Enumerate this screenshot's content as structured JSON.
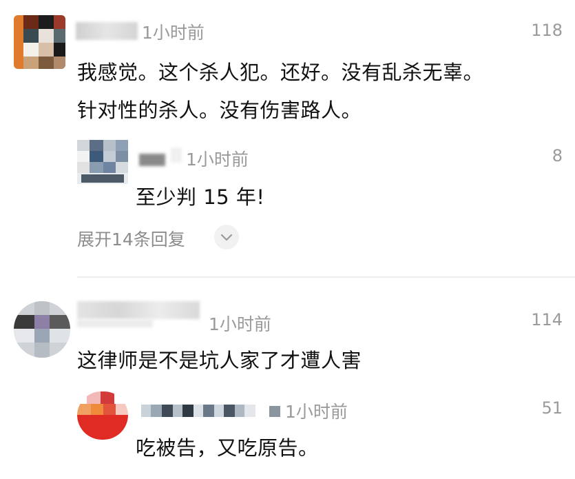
{
  "comments": [
    {
      "time": "1小时前",
      "likes": "118",
      "text_line1": "我感觉。这个杀人犯。还好。没有乱杀无辜。",
      "text_line2": "针对性的杀人。没有伤害路人。",
      "reply": {
        "time": "1小时前",
        "likes": "8",
        "text": "至少判 15 年!"
      },
      "expand_label": "展开14条回复"
    },
    {
      "time": "1小时前",
      "likes": "114",
      "text": "这律师是不是坑人家了才遭人害",
      "reply": {
        "time": "1小时前",
        "likes": "51",
        "text": "吃被告，又吃原告。"
      }
    }
  ],
  "icons": {
    "expand": "chevron-down-icon"
  },
  "colors": {
    "text": "#111111",
    "meta": "#9a9a9a",
    "divider": "#eeeeee"
  }
}
